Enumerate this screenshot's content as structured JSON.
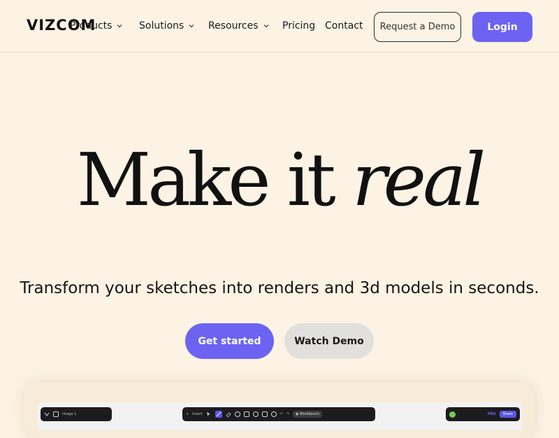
{
  "header": {
    "logo": "VIZCOM",
    "nav": {
      "products": "Products",
      "solutions": "Solutions",
      "resources": "Resources",
      "pricing": "Pricing",
      "contact": "Contact"
    },
    "request_demo_label": "Request a Demo",
    "login_label": "Login"
  },
  "hero": {
    "title_part1": "Make it",
    "title_part2": "real",
    "subtitle": "Transform your sketches into renders and 3d models in seconds.",
    "get_started_label": "Get started",
    "watch_demo_label": "Watch Demo"
  },
  "preview": {
    "layer_name": "Image 1",
    "insert_label": "Insert",
    "workbench_label": "Workbench",
    "pro_badge": "PRO",
    "share_label": "Share",
    "icons": [
      "vizcom-logo-icon",
      "image-icon",
      "plus-icon",
      "select-icon",
      "brush-icon",
      "eraser-icon",
      "shape-icon",
      "lasso-icon",
      "transform-icon",
      "undo-icon",
      "redo-icon",
      "workbench-icon",
      "user-avatar-icon"
    ]
  },
  "colors": {
    "background": "#fcf3e4",
    "accent": "#6c63f2",
    "secondary_button": "#e2e0dd",
    "toolbar": "#1c1c1e"
  }
}
